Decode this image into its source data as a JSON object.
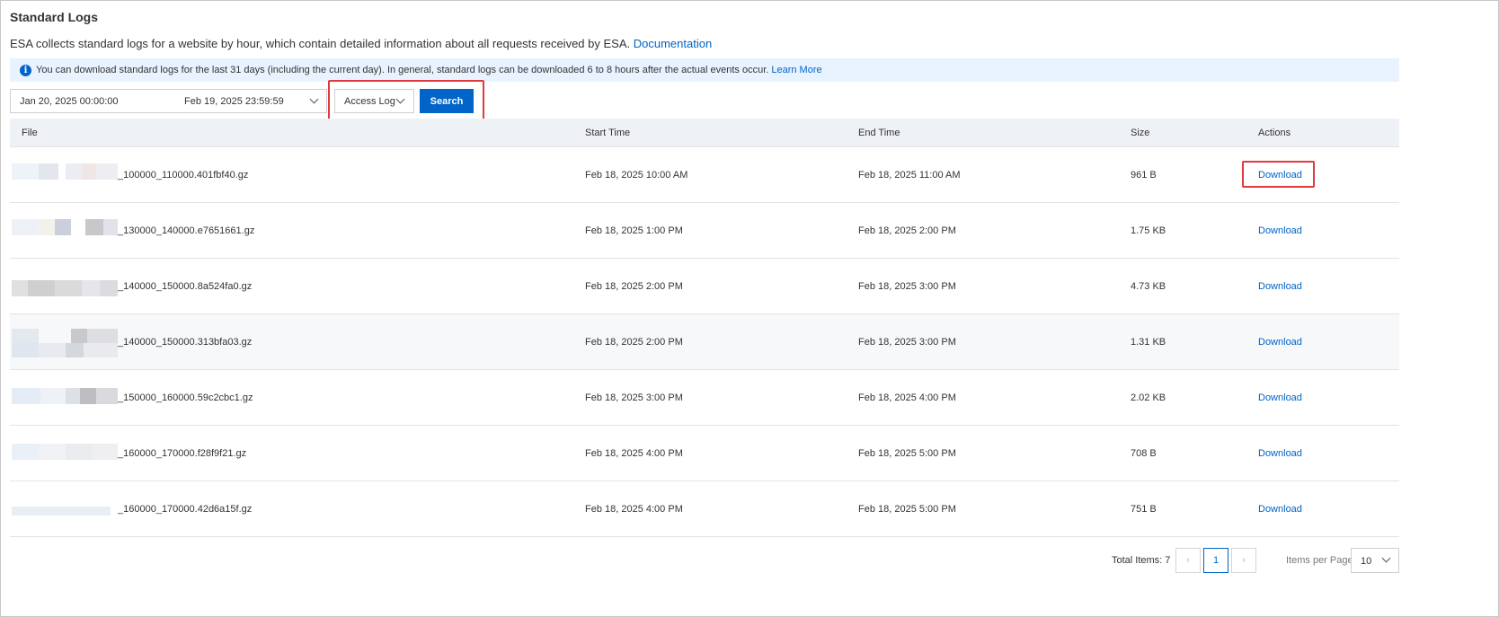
{
  "page": {
    "title": "Standard Logs",
    "description": "ESA collects standard logs for a website by hour, which contain detailed information about all requests received by ESA.",
    "doc_link": "Documentation"
  },
  "notice": {
    "text": "You can download standard logs for the last 31 days (including the current day). In general, standard logs can be downloaded 6 to 8 hours after the actual events occur.",
    "link": "Learn More"
  },
  "filters": {
    "start": "Jan 20, 2025 00:00:00",
    "end": "Feb 19, 2025 23:59:59",
    "log_type": "Access Log",
    "search_label": "Search"
  },
  "table": {
    "headers": {
      "file": "File",
      "start": "Start Time",
      "end": "End Time",
      "size": "Size",
      "actions": "Actions"
    },
    "rows": [
      {
        "file": "_100000_110000.401fbf40.gz",
        "start": "Feb 18, 2025 10:00 AM",
        "end": "Feb 18, 2025 11:00 AM",
        "size": "961 B",
        "action": "Download"
      },
      {
        "file": "_130000_140000.e7651661.gz",
        "start": "Feb 18, 2025 1:00 PM",
        "end": "Feb 18, 2025 2:00 PM",
        "size": "1.75 KB",
        "action": "Download"
      },
      {
        "file": "_140000_150000.8a524fa0.gz",
        "start": "Feb 18, 2025 2:00 PM",
        "end": "Feb 18, 2025 3:00 PM",
        "size": "4.73 KB",
        "action": "Download"
      },
      {
        "file": "_140000_150000.313bfa03.gz",
        "start": "Feb 18, 2025 2:00 PM",
        "end": "Feb 18, 2025 3:00 PM",
        "size": "1.31 KB",
        "action": "Download"
      },
      {
        "file": "_150000_160000.59c2cbc1.gz",
        "start": "Feb 18, 2025 3:00 PM",
        "end": "Feb 18, 2025 4:00 PM",
        "size": "2.02 KB",
        "action": "Download"
      },
      {
        "file": "_160000_170000.f28f9f21.gz",
        "start": "Feb 18, 2025 4:00 PM",
        "end": "Feb 18, 2025 5:00 PM",
        "size": "708 B",
        "action": "Download"
      },
      {
        "file": "_160000_170000.42d6a15f.gz",
        "start": "Feb 18, 2025 4:00 PM",
        "end": "Feb 18, 2025 5:00 PM",
        "size": "751 B",
        "action": "Download"
      }
    ]
  },
  "pagination": {
    "total_label": "Total Items: 7",
    "current_page": "1",
    "per_page_label": "Items per Page:",
    "per_page": "10"
  },
  "colors": {
    "accent": "#0064c8",
    "highlight": "#e0393e",
    "notice_bg": "#e8f3ff"
  }
}
